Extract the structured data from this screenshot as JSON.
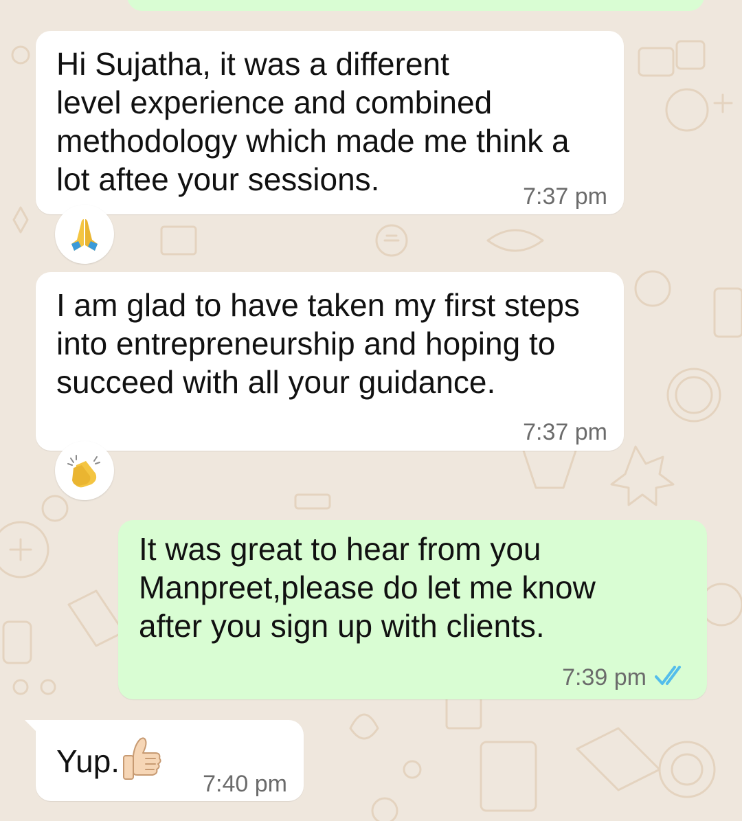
{
  "chat": {
    "messages": [
      {
        "direction": "incoming",
        "text": "Hi Sujatha, it was a different\nlevel experience  and combined\nmethodology which made me think a\nlot aftee your sessions.",
        "time": "7:37 pm",
        "reaction_icon": "folded-hands-icon"
      },
      {
        "direction": "incoming",
        "text": "I am glad to have taken my first steps\ninto entrepreneurship and hoping to\nsucceed with all your guidance.",
        "time": "7:37 pm",
        "reaction_icon": "clapping-hands-icon"
      },
      {
        "direction": "outgoing",
        "text": "It was great to hear from you\nManpreet,please do let me know\nafter you sign up with clients.",
        "time": "7:39 pm",
        "status_icon": "double-check-read-icon"
      },
      {
        "direction": "incoming",
        "text": "Yup.",
        "time": "7:40 pm",
        "inline_icon": "thumbs-up-icon"
      }
    ]
  },
  "colors": {
    "wallpaper": "#efe7dd",
    "wallpaper_doodle": "#e6d5c2",
    "incoming_bubble": "#ffffff",
    "outgoing_bubble": "#d9fdd3",
    "timestamp": "#6b6b6b",
    "read_check": "#53bdeb"
  }
}
